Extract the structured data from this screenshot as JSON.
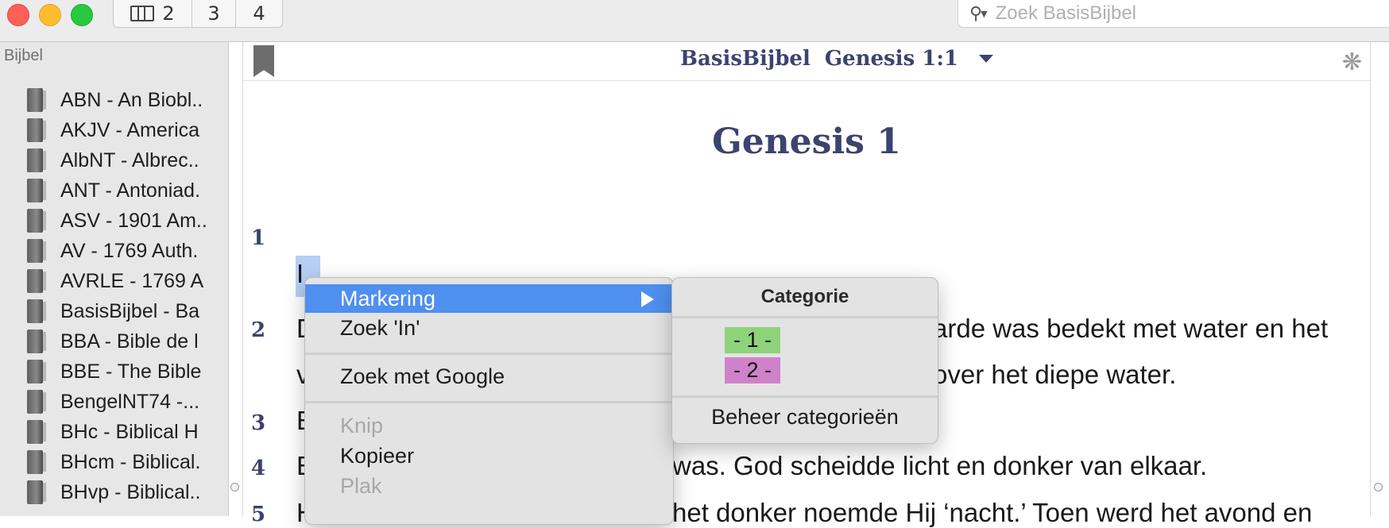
{
  "toolbar": {
    "tab_numbers": [
      "2",
      "3",
      "4"
    ],
    "search_placeholder": "Zoek BasisBijbel"
  },
  "sidebar": {
    "header": "Bijbel",
    "modules": [
      "ABN - An Biobl..",
      "AKJV - America",
      "AlbNT - Albrec..",
      "ANT - Antoniad.",
      "ASV - 1901 Am..",
      "AV - 1769 Auth.",
      "AVRLE - 1769 A",
      "BasisBijbel - Ba",
      "BBA - Bible de l",
      "BBE - The Bible",
      "BengelNT74 -...",
      "BHc - Biblical H",
      "BHcm - Biblical.",
      "BHvp - Biblical.."
    ]
  },
  "pane": {
    "module": "BasisBijbel",
    "reference": "Genesis 1:1",
    "chapter_title": "Genesis 1",
    "verses": [
      {
        "num": "1",
        "lines": [
          "I"
        ]
      },
      {
        "num": "2",
        "lines": [
          "D",
          "arde was bedekt met water en het",
          "v",
          "over het diepe water."
        ]
      },
      {
        "num": "3",
        "lines": [
          "E"
        ]
      },
      {
        "num": "4",
        "lines": [
          "E",
          "was. God scheidde licht en donker van elkaar."
        ]
      },
      {
        "num": "5",
        "lines": [
          "H",
          "het donker noemde Hij ‘nacht.’ Toen werd het avond en"
        ]
      }
    ]
  },
  "context_menu": {
    "markering": "Markering",
    "zoek_in": "Zoek 'In'",
    "zoek_google": "Zoek met Google",
    "knip": "Knip",
    "kopieer": "Kopieer",
    "plak": "Plak"
  },
  "submenu": {
    "header": "Categorie",
    "categories": [
      {
        "label": "- 1 -",
        "color": "#8ed37c"
      },
      {
        "label": "- 2 -",
        "color": "#cf82c9"
      }
    ],
    "manage": "Beheer categorieën"
  },
  "colors": {
    "accent": "#4f8ff0",
    "title_blue": "#3c4370",
    "selection": "#b7cff3"
  }
}
